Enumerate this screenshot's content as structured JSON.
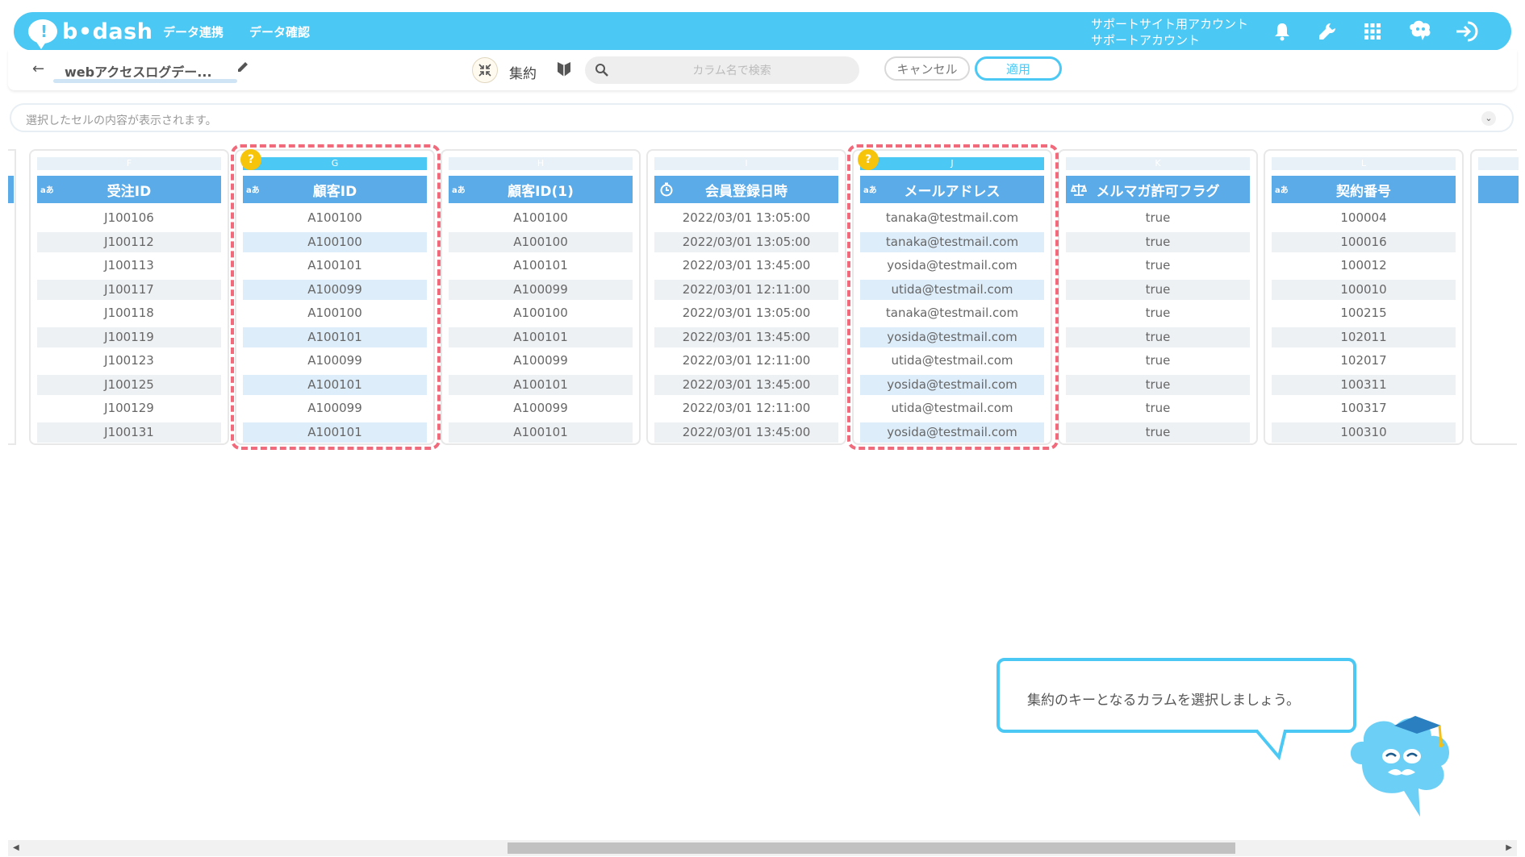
{
  "header": {
    "logo_text": "b•dash",
    "nav": [
      "データ連携",
      "データ確認"
    ],
    "account_line1": "サポートサイト用アカウント",
    "account_line2": "サポートアカウント"
  },
  "subbar": {
    "back_icon": "arrow-left-icon",
    "dataset_name": "webアクセスログデー...",
    "mode_label": "集約",
    "search_placeholder": "カラム名で検索",
    "cancel_label": "キャンセル",
    "apply_label": "適用"
  },
  "cellbar": {
    "placeholder": "選択したセルの内容が表示されます。"
  },
  "columns": [
    {
      "letter": "F",
      "type": "text",
      "name": "受注ID",
      "key": false,
      "values": [
        "J100106",
        "J100112",
        "J100113",
        "J100117",
        "J100118",
        "J100119",
        "J100123",
        "J100125",
        "J100129",
        "J100131"
      ]
    },
    {
      "letter": "G",
      "type": "text",
      "name": "顧客ID",
      "key": true,
      "values": [
        "A100100",
        "A100100",
        "A100101",
        "A100099",
        "A100100",
        "A100101",
        "A100099",
        "A100101",
        "A100099",
        "A100101"
      ]
    },
    {
      "letter": "H",
      "type": "text",
      "name": "顧客ID(1)",
      "key": false,
      "values": [
        "A100100",
        "A100100",
        "A100101",
        "A100099",
        "A100100",
        "A100101",
        "A100099",
        "A100101",
        "A100099",
        "A100101"
      ]
    },
    {
      "letter": "I",
      "type": "datetime",
      "name": "会員登録日時",
      "key": false,
      "values": [
        "2022/03/01 13:05:00",
        "2022/03/01 13:05:00",
        "2022/03/01 13:45:00",
        "2022/03/01 12:11:00",
        "2022/03/01 13:05:00",
        "2022/03/01 13:45:00",
        "2022/03/01 12:11:00",
        "2022/03/01 13:45:00",
        "2022/03/01 12:11:00",
        "2022/03/01 13:45:00"
      ]
    },
    {
      "letter": "J",
      "type": "text",
      "name": "メールアドレス",
      "key": true,
      "values": [
        "tanaka@testmail.com",
        "tanaka@testmail.com",
        "yosida@testmail.com",
        "utida@testmail.com",
        "tanaka@testmail.com",
        "yosida@testmail.com",
        "utida@testmail.com",
        "yosida@testmail.com",
        "utida@testmail.com",
        "yosida@testmail.com"
      ]
    },
    {
      "letter": "K",
      "type": "boolean",
      "name": "メルマガ許可フラグ",
      "key": false,
      "values": [
        "true",
        "true",
        "true",
        "true",
        "true",
        "true",
        "true",
        "true",
        "true",
        "true"
      ]
    },
    {
      "letter": "L",
      "type": "text",
      "name": "契約番号",
      "key": false,
      "values": [
        "100004",
        "100016",
        "100012",
        "100010",
        "100215",
        "102011",
        "102017",
        "100311",
        "100317",
        "100310"
      ]
    }
  ],
  "type_badge_text": "aあ",
  "key_icon_text": "?",
  "guide": {
    "message": "集約のキーとなるカラムを選択しましょう。"
  },
  "colors": {
    "accent": "#4cc8f4",
    "header_blue": "#5aabe8",
    "key_yellow": "#f6c40b",
    "highlight_dash": "#f06a7b"
  }
}
